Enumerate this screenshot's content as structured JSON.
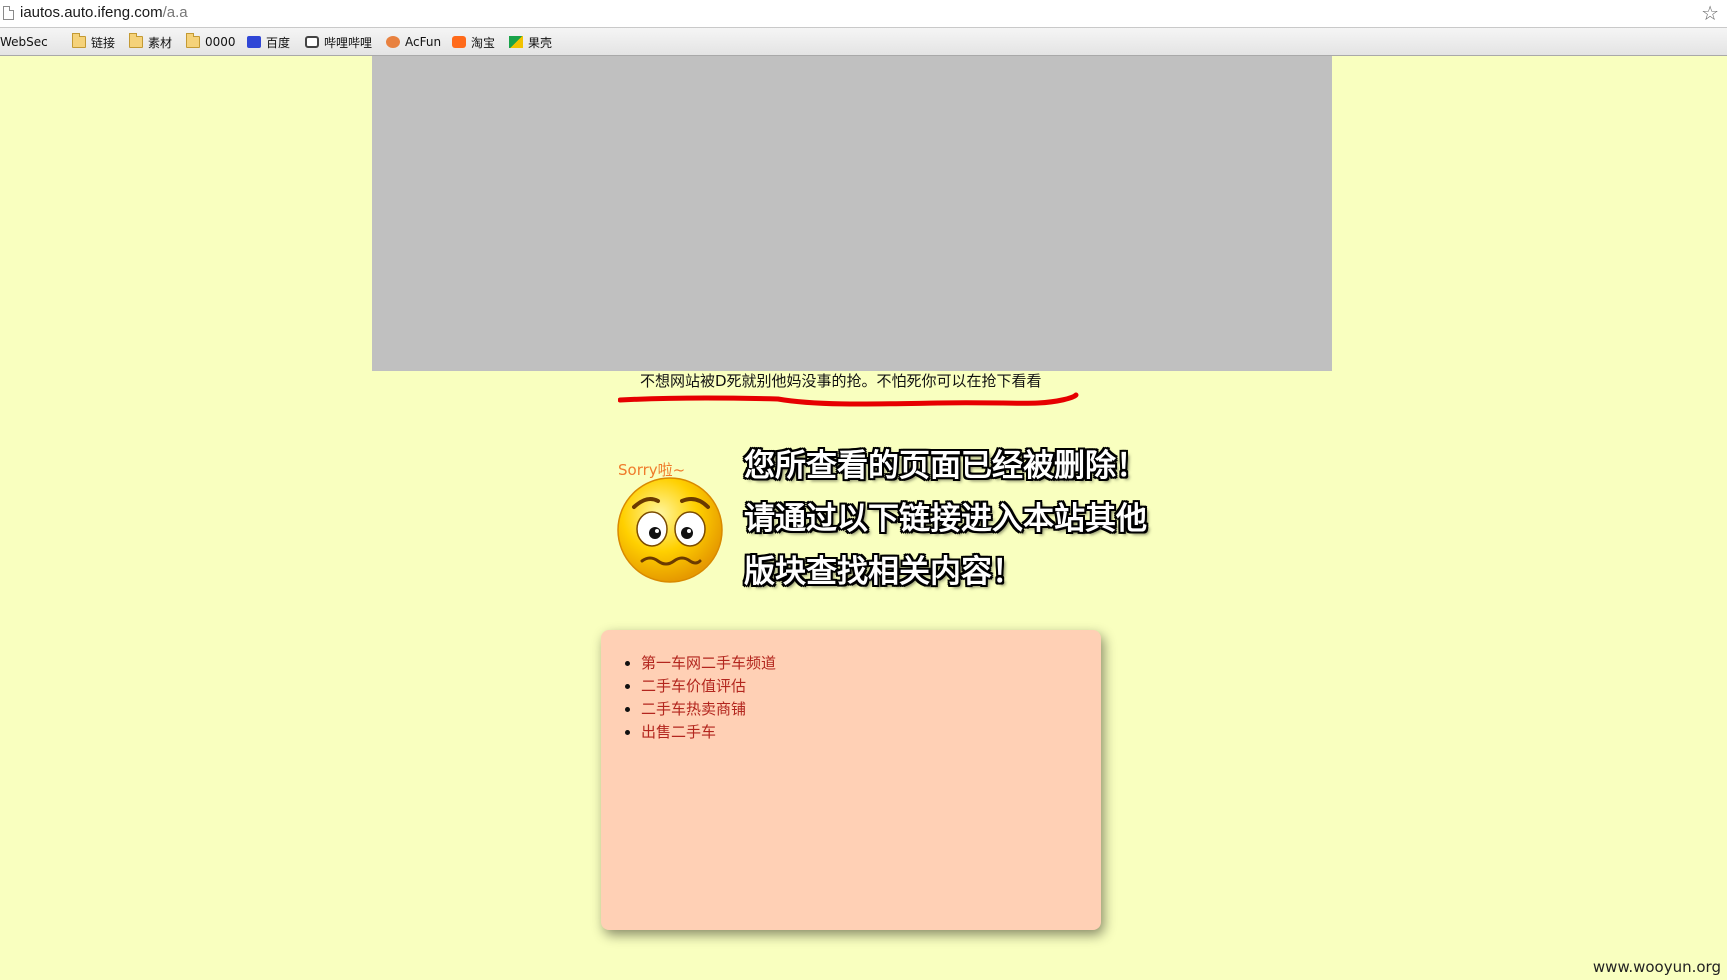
{
  "browser": {
    "url_host": "iautos.auto.ifeng.com",
    "url_path": "/a.a",
    "star_icon": "star-icon"
  },
  "bookmarks": [
    {
      "label": "WebSec",
      "icon": "folder-icon"
    },
    {
      "label": "链接",
      "icon": "folder-icon"
    },
    {
      "label": "素材",
      "icon": "folder-icon"
    },
    {
      "label": "0000",
      "icon": "folder-icon"
    },
    {
      "label": "百度",
      "icon": "baidu-paw-icon"
    },
    {
      "label": "哔哩哔哩",
      "icon": "bilibili-tv-icon"
    },
    {
      "label": "AcFun",
      "icon": "acfun-icon"
    },
    {
      "label": "淘宝",
      "icon": "taobao-icon"
    },
    {
      "label": "果壳",
      "icon": "guokr-icon"
    }
  ],
  "page": {
    "warning_text": "不想网站被D死就别他妈没事的抢。不怕死你可以在抢下看看",
    "emoji_caption": "Sorry啦~",
    "message_lines": [
      "您所查看的页面已经被删除！",
      "请通过以下链接进入本站其他",
      "版块查找相关内容！"
    ],
    "links": [
      "第一车网二手车频道",
      "二手车价值评估",
      "二手车热卖商铺",
      "出售二手车"
    ],
    "watermark": "www.wooyun.org"
  },
  "colors": {
    "page_background": "#f9ffbf",
    "banner_gray": "#c0c0c0",
    "links_box": "#ffd0b5",
    "link_text": "#b3261e",
    "underline_mark": "#e60000"
  }
}
